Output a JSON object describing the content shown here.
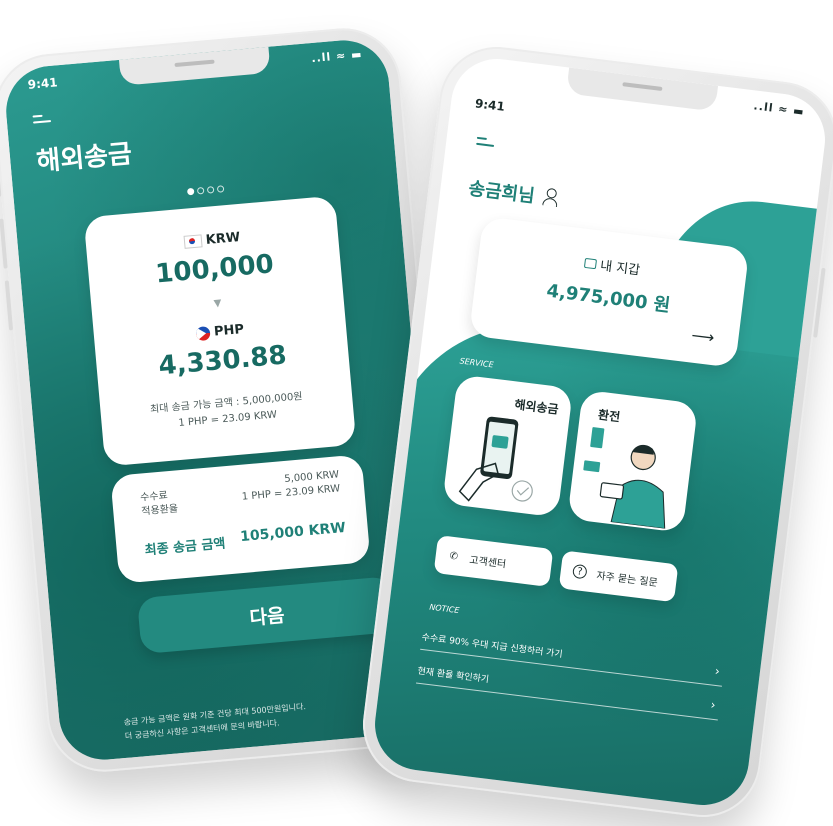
{
  "left_phone": {
    "status": {
      "time": "9:41",
      "icons": "..ll ≈ ▬"
    },
    "title": "해외송금",
    "send": {
      "currency": "KRW",
      "amount": "100,000"
    },
    "receive": {
      "currency": "PHP",
      "amount": "4,330.88"
    },
    "limit_text": "최대 송금 가능 금액 : 5,000,000원",
    "rate_text": "1 PHP = 23.09 KRW",
    "fee": {
      "label_fee": "수수료",
      "label_rate": "적용환율",
      "fee_value": "5,000 KRW",
      "rate_value": "1 PHP = 23.09 KRW",
      "final_label": "최종 송금 금액",
      "final_value": "105,000 KRW"
    },
    "next_button": "다음",
    "footnote_1": "송금 가능 금액은 원화 기준 건당 최대 500만원입니다.",
    "footnote_2": "더 궁금하신 사항은 고객센터에 문의 바랍니다."
  },
  "right_phone": {
    "status": {
      "time": "9:41",
      "icons": "..ll ≈ ▬"
    },
    "greeting": "송금희님",
    "wallet": {
      "label": "내 지갑",
      "amount": "4,975,000 원"
    },
    "service_label": "SERVICE",
    "services": [
      {
        "title": "해외송금"
      },
      {
        "title": "환전"
      }
    ],
    "help": [
      {
        "icon": "phone-icon",
        "label": "고객센터"
      },
      {
        "icon": "question-icon",
        "label": "자주 묻는 질문"
      }
    ],
    "notice_label": "NOTICE",
    "notices": [
      "수수료 90% 우대 지급 신청하러 가기",
      "현재 환율 확인하기"
    ]
  },
  "colors": {
    "teal": "#1f8077",
    "teal_light": "#2da196",
    "teal_dark": "#176a62"
  }
}
